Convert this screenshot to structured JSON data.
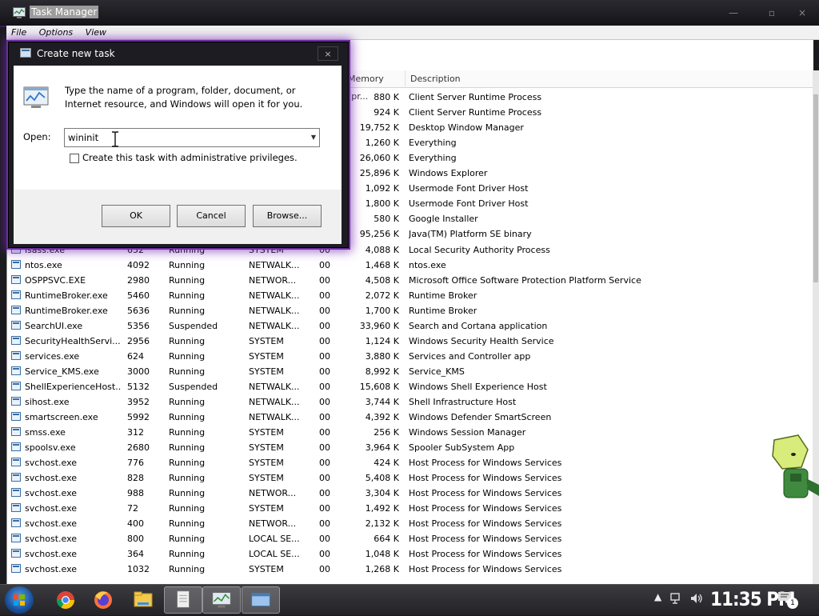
{
  "window": {
    "title": "Task Manager",
    "menu": [
      "File",
      "Options",
      "View"
    ]
  },
  "table": {
    "headers": {
      "memory": "Memory (pr...",
      "description": "Description"
    },
    "top_rows": [
      {
        "memory": "880 K",
        "description": "Client Server Runtime Process"
      },
      {
        "memory": "924 K",
        "description": "Client Server Runtime Process"
      },
      {
        "memory": "19,752 K",
        "description": "Desktop Window Manager"
      },
      {
        "memory": "1,260 K",
        "description": "Everything"
      },
      {
        "memory": "26,060 K",
        "description": "Everything"
      },
      {
        "memory": "25,896 K",
        "description": "Windows Explorer"
      },
      {
        "memory": "1,092 K",
        "description": "Usermode Font Driver Host"
      },
      {
        "memory": "1,800 K",
        "description": "Usermode Font Driver Host"
      },
      {
        "memory": "580 K",
        "description": "Google Installer"
      },
      {
        "memory": "95,256 K",
        "description": "Java(TM) Platform SE binary"
      }
    ],
    "rows": [
      {
        "name": "lsass.exe",
        "pid": "652",
        "status": "Running",
        "user": "SYSTEM",
        "cpu": "00",
        "memory": "4,088 K",
        "description": "Local Security Authority Process"
      },
      {
        "name": "ntos.exe",
        "pid": "4092",
        "status": "Running",
        "user": "NETWALK...",
        "cpu": "00",
        "memory": "1,468 K",
        "description": "ntos.exe"
      },
      {
        "name": "OSPPSVC.EXE",
        "pid": "2980",
        "status": "Running",
        "user": "NETWOR...",
        "cpu": "00",
        "memory": "4,508 K",
        "description": "Microsoft Office Software Protection Platform Service"
      },
      {
        "name": "RuntimeBroker.exe",
        "pid": "5460",
        "status": "Running",
        "user": "NETWALK...",
        "cpu": "00",
        "memory": "2,072 K",
        "description": "Runtime Broker"
      },
      {
        "name": "RuntimeBroker.exe",
        "pid": "5636",
        "status": "Running",
        "user": "NETWALK...",
        "cpu": "00",
        "memory": "1,700 K",
        "description": "Runtime Broker"
      },
      {
        "name": "SearchUI.exe",
        "pid": "5356",
        "status": "Suspended",
        "user": "NETWALK...",
        "cpu": "00",
        "memory": "33,960 K",
        "description": "Search and Cortana application"
      },
      {
        "name": "SecurityHealthServi...",
        "pid": "2956",
        "status": "Running",
        "user": "SYSTEM",
        "cpu": "00",
        "memory": "1,124 K",
        "description": "Windows Security Health Service"
      },
      {
        "name": "services.exe",
        "pid": "624",
        "status": "Running",
        "user": "SYSTEM",
        "cpu": "00",
        "memory": "3,880 K",
        "description": "Services and Controller app"
      },
      {
        "name": "Service_KMS.exe",
        "pid": "3000",
        "status": "Running",
        "user": "SYSTEM",
        "cpu": "00",
        "memory": "8,992 K",
        "description": "Service_KMS"
      },
      {
        "name": "ShellExperienceHost...",
        "pid": "5132",
        "status": "Suspended",
        "user": "NETWALK...",
        "cpu": "00",
        "memory": "15,608 K",
        "description": "Windows Shell Experience Host"
      },
      {
        "name": "sihost.exe",
        "pid": "3952",
        "status": "Running",
        "user": "NETWALK...",
        "cpu": "00",
        "memory": "3,744 K",
        "description": "Shell Infrastructure Host"
      },
      {
        "name": "smartscreen.exe",
        "pid": "5992",
        "status": "Running",
        "user": "NETWALK...",
        "cpu": "00",
        "memory": "4,392 K",
        "description": "Windows Defender SmartScreen"
      },
      {
        "name": "smss.exe",
        "pid": "312",
        "status": "Running",
        "user": "SYSTEM",
        "cpu": "00",
        "memory": "256 K",
        "description": "Windows Session Manager"
      },
      {
        "name": "spoolsv.exe",
        "pid": "2680",
        "status": "Running",
        "user": "SYSTEM",
        "cpu": "00",
        "memory": "3,964 K",
        "description": "Spooler SubSystem App"
      },
      {
        "name": "svchost.exe",
        "pid": "776",
        "status": "Running",
        "user": "SYSTEM",
        "cpu": "00",
        "memory": "424 K",
        "description": "Host Process for Windows Services"
      },
      {
        "name": "svchost.exe",
        "pid": "828",
        "status": "Running",
        "user": "SYSTEM",
        "cpu": "00",
        "memory": "5,408 K",
        "description": "Host Process for Windows Services"
      },
      {
        "name": "svchost.exe",
        "pid": "988",
        "status": "Running",
        "user": "NETWOR...",
        "cpu": "00",
        "memory": "3,304 K",
        "description": "Host Process for Windows Services"
      },
      {
        "name": "svchost.exe",
        "pid": "72",
        "status": "Running",
        "user": "SYSTEM",
        "cpu": "00",
        "memory": "1,492 K",
        "description": "Host Process for Windows Services"
      },
      {
        "name": "svchost.exe",
        "pid": "400",
        "status": "Running",
        "user": "NETWOR...",
        "cpu": "00",
        "memory": "2,132 K",
        "description": "Host Process for Windows Services"
      },
      {
        "name": "svchost.exe",
        "pid": "800",
        "status": "Running",
        "user": "LOCAL SE...",
        "cpu": "00",
        "memory": "664 K",
        "description": "Host Process for Windows Services"
      },
      {
        "name": "svchost.exe",
        "pid": "364",
        "status": "Running",
        "user": "LOCAL SE...",
        "cpu": "00",
        "memory": "1,048 K",
        "description": "Host Process for Windows Services"
      },
      {
        "name": "svchost.exe",
        "pid": "1032",
        "status": "Running",
        "user": "SYSTEM",
        "cpu": "00",
        "memory": "1,268 K",
        "description": "Host Process for Windows Services"
      }
    ]
  },
  "dialog": {
    "title": "Create new task",
    "instructions": "Type the name of a program, folder, document, or Internet resource, and Windows will open it for you.",
    "open_label": "Open:",
    "open_value": "wininit",
    "admin_label": "Create this task with administrative privileges.",
    "ok_label": "OK",
    "cancel_label": "Cancel",
    "browse_label": "Browse..."
  },
  "taskbar": {
    "clock": "11:35 PM",
    "notification_count": "1"
  },
  "colors": {
    "accent_glow": "#6a2ea0",
    "taskbar": "#2b2b30",
    "titlebar": "#1b1b1f"
  },
  "icons": [
    "task-manager-icon",
    "start-orb-icon",
    "chrome-icon",
    "firefox-icon",
    "file-explorer-icon",
    "notepad-icon",
    "task-manager-taskbar-icon",
    "run-dialog-taskbar-icon",
    "network-icon",
    "volume-icon",
    "action-center-icon"
  ]
}
